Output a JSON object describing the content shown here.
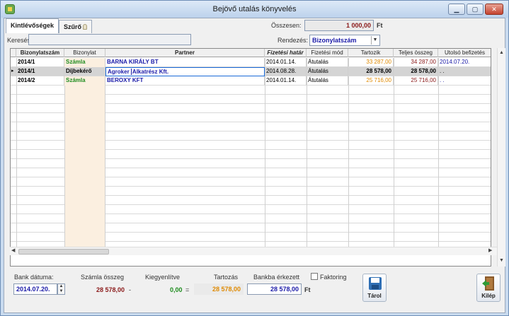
{
  "window": {
    "title": "Bejövő utalás könyvelés"
  },
  "tabs": [
    {
      "label": "Kintlévőségek"
    },
    {
      "label": "Szűrő"
    }
  ],
  "total": {
    "label": "Összesen:",
    "value": "1 000,00",
    "unit": "Ft"
  },
  "search": {
    "label": "Keresés:",
    "value": ""
  },
  "sort": {
    "label": "Rendezés:",
    "value": "Bizonylatszám"
  },
  "table": {
    "columns": [
      "Bizonylatszám",
      "Bizonylat",
      "Partner",
      "Fizetési határ",
      "Fizetési mód",
      "Tartozik",
      "Teljes összeg",
      "Utolsó befizetés"
    ],
    "rows": [
      {
        "doc_no": "2014/1",
        "doc_type": "Számla",
        "partner": "BARNA KIRÁLY BT",
        "due": "2014.01.14.",
        "pay_mode": "Átutalás",
        "owed": "33 287,00",
        "total": "34 287,00",
        "last_paid": "2014.07.20."
      },
      {
        "doc_no": "2014/1",
        "doc_type": "Díjbekérő",
        "partner_a": "Agroker",
        "partner_b": "Alkatrész Kft.",
        "due": "2014.08.28.",
        "pay_mode": "Átutalás",
        "owed": "28 578,00",
        "total": "28 578,00",
        "last_paid": ". ."
      },
      {
        "doc_no": "2014/2",
        "doc_type": "Számla",
        "partner": "BEROXY KFT",
        "due": "2014.01.14.",
        "pay_mode": "Átutalás",
        "owed": "25 716,00",
        "total": "25 716,00",
        "last_paid": ". ."
      }
    ]
  },
  "footer": {
    "bank_date": {
      "label": "Bank dátuma:",
      "value": "2014.07.20."
    },
    "invoice_sum": {
      "label": "Számla összeg",
      "value": "28 578,00"
    },
    "minus": "-",
    "settled": {
      "label": "Kiegyenlítve",
      "value": "0,00"
    },
    "equals": "=",
    "owed": {
      "label": "Tartozás",
      "value": "28 578,00"
    },
    "arrived": {
      "label": "Bankba érkezett",
      "value": "28 578,00",
      "unit": "Ft"
    },
    "factoring": {
      "label": "Faktoring",
      "checked": false
    },
    "save_label": "Tárol",
    "exit_label": "Kilép"
  },
  "icons": [
    "app-icon",
    "minimize-icon",
    "maximize-icon",
    "close-icon",
    "bulb-icon",
    "dropdown-icon",
    "row-pointer-icon",
    "spin-icon",
    "floppy-disk-icon",
    "exit-door-icon"
  ],
  "colors": {
    "green": "#1e8c1e",
    "blue": "#1a1aa8",
    "orange": "#e08a00",
    "dark_red": "#8b1a1a",
    "title_bar": "#bcd2ec"
  }
}
